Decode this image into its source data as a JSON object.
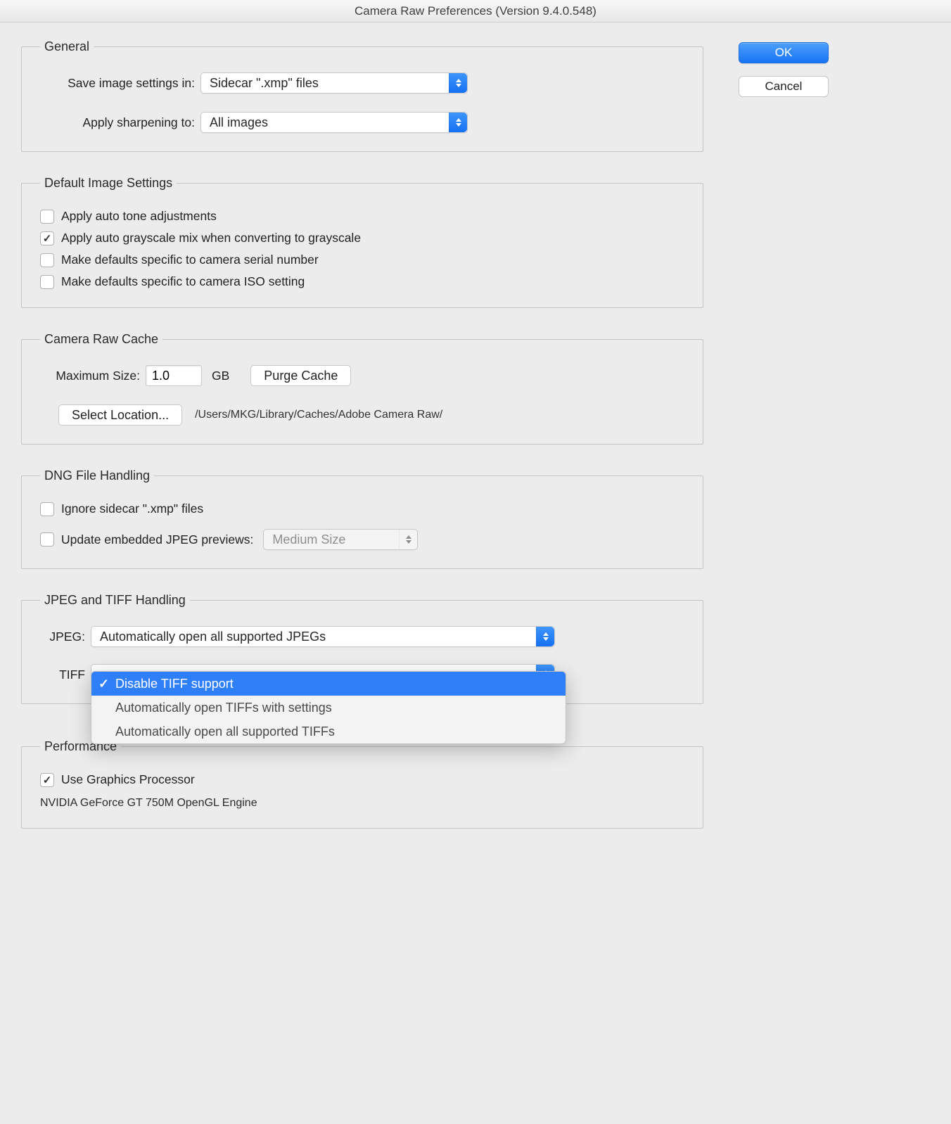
{
  "title": "Camera Raw Preferences  (Version 9.4.0.548)",
  "buttons": {
    "ok": "OK",
    "cancel": "Cancel"
  },
  "general": {
    "legend": "General",
    "save_label": "Save image settings in:",
    "save_value": "Sidecar \".xmp\" files",
    "sharpen_label": "Apply sharpening to:",
    "sharpen_value": "All images"
  },
  "defaults": {
    "legend": "Default Image Settings",
    "auto_tone": "Apply auto tone adjustments",
    "auto_gray": "Apply auto grayscale mix when converting to grayscale",
    "serial": "Make defaults specific to camera serial number",
    "iso": "Make defaults specific to camera ISO setting"
  },
  "cache": {
    "legend": "Camera Raw Cache",
    "max_label": "Maximum Size:",
    "max_value": "1.0",
    "unit": "GB",
    "purge": "Purge Cache",
    "select_loc": "Select Location...",
    "path": "/Users/MKG/Library/Caches/Adobe Camera Raw/"
  },
  "dng": {
    "legend": "DNG File Handling",
    "ignore": "Ignore sidecar \".xmp\" files",
    "update": "Update embedded JPEG previews:",
    "size": "Medium Size"
  },
  "jt": {
    "legend": "JPEG and TIFF Handling",
    "jpeg_label": "JPEG:",
    "jpeg_value": "Automatically open all supported JPEGs",
    "tiff_label": "TIFF",
    "tiff_options": [
      "Disable TIFF support",
      "Automatically open TIFFs with settings",
      "Automatically open all supported TIFFs"
    ]
  },
  "perf": {
    "legend": "Performance",
    "use_gpu": "Use Graphics Processor",
    "gpu_name": "NVIDIA GeForce GT 750M OpenGL Engine"
  }
}
